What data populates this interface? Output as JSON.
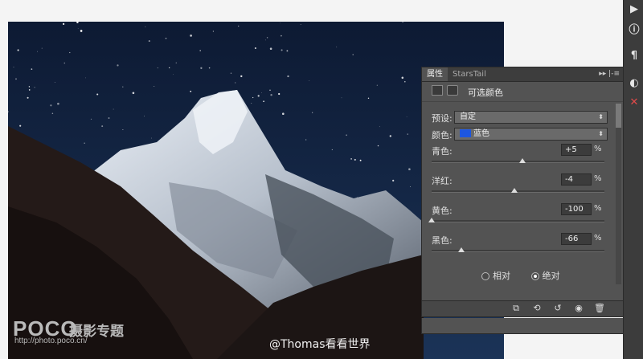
{
  "panel": {
    "tabs": [
      "属性",
      "StarsTail"
    ],
    "menu_glyph": "▸▸ |‑≡",
    "title": "可选颜色",
    "preset_label": "预设:",
    "preset_value": "自定",
    "color_label": "颜色:",
    "color_value": "蓝色",
    "color_swatch": "#1d56e0",
    "sliders": [
      {
        "label": "青色:",
        "value": "+5",
        "unit": "%",
        "level": 0.525
      },
      {
        "label": "洋红:",
        "value": "-4",
        "unit": "%",
        "level": 0.48
      },
      {
        "label": "黄色:",
        "value": "-100",
        "unit": "%",
        "level": 0.0
      },
      {
        "label": "黑色:",
        "value": "-66",
        "unit": "%",
        "level": 0.17
      }
    ],
    "method": {
      "relative_label": "相对",
      "absolute_label": "绝对",
      "selected": "absolute"
    },
    "footer_icons": [
      "clip-to-layer-icon",
      "view-previous-icon",
      "reset-icon",
      "visibility-icon",
      "trash-icon"
    ]
  },
  "dock": {
    "icons": [
      "play-icon",
      "info-icon",
      "paragraph-icon",
      "adjustments-icon",
      "tools-icon"
    ]
  },
  "watermark": {
    "brand": "POCO",
    "brand_sub": "摄影专题",
    "url": "http://photo.poco.cn/",
    "credit": "@Thomas看看世界"
  }
}
